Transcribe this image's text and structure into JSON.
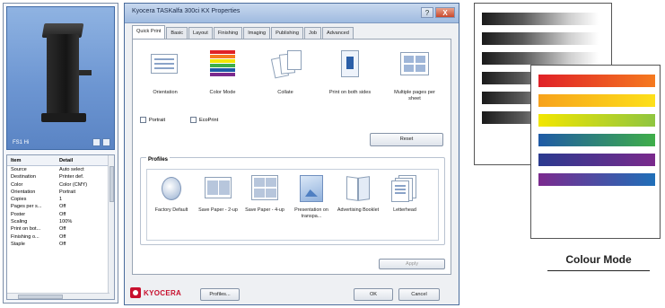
{
  "left_panel": {
    "printer_model": "FS1 Hi",
    "table": {
      "headers": [
        "Item",
        "Detail"
      ],
      "rows": [
        [
          "Source",
          "Auto select"
        ],
        [
          "Destination",
          "Printer def."
        ],
        [
          "Color",
          "Color (CMY)"
        ],
        [
          "Orientation",
          "Portrait"
        ],
        [
          "Copies",
          "1"
        ],
        [
          "Pages per s...",
          "Off"
        ],
        [
          "Poster",
          "Off"
        ],
        [
          "Scaling",
          "100%"
        ],
        [
          "Print on bot...",
          "Off"
        ],
        [
          "Finishing o...",
          "Off"
        ],
        [
          "Staple",
          "Off"
        ]
      ]
    }
  },
  "dialog": {
    "title": "Kyocera TASKalfa 300ci KX Properties",
    "title_buttons": [
      "?",
      "X"
    ],
    "tabs": [
      "Quick Print",
      "Basic",
      "Layout",
      "Finishing",
      "Imaging",
      "Publishing",
      "Job",
      "Advanced"
    ],
    "quick_print": [
      {
        "label": "Orientation"
      },
      {
        "label": "Color Mode"
      },
      {
        "label": "Collate"
      },
      {
        "label": "Print on both sides"
      },
      {
        "label": "Multiple pages per sheet"
      }
    ],
    "checkboxes": [
      "Portrait",
      "EcoPrint"
    ],
    "reset_label": "Reset",
    "profiles_title": "Profiles",
    "profiles": [
      {
        "label": "Factory Default"
      },
      {
        "label": "Save Paper - 2-up"
      },
      {
        "label": "Save Paper - 4-up"
      },
      {
        "label": "Presentation on transpa..."
      },
      {
        "label": "Advertising Booklet"
      },
      {
        "label": "Letterhead"
      }
    ],
    "apply_label": "Apply",
    "profiles_button_label": "Profiles...",
    "ok_label": "OK",
    "cancel_label": "Cancel",
    "logo_text": "KYOCERA"
  },
  "colour_mode": {
    "caption": "Colour Mode",
    "colour_bars": [
      [
        "#e02127",
        "#f57a1f"
      ],
      [
        "#f7a21b",
        "#fde01a"
      ],
      [
        "#f2e600",
        "#8fc540"
      ],
      [
        "#1f5aa6",
        "#3fae49"
      ],
      [
        "#2b3a8f",
        "#7a2a8c"
      ],
      [
        "#7b2a8e",
        "#1f6fb8"
      ]
    ]
  }
}
